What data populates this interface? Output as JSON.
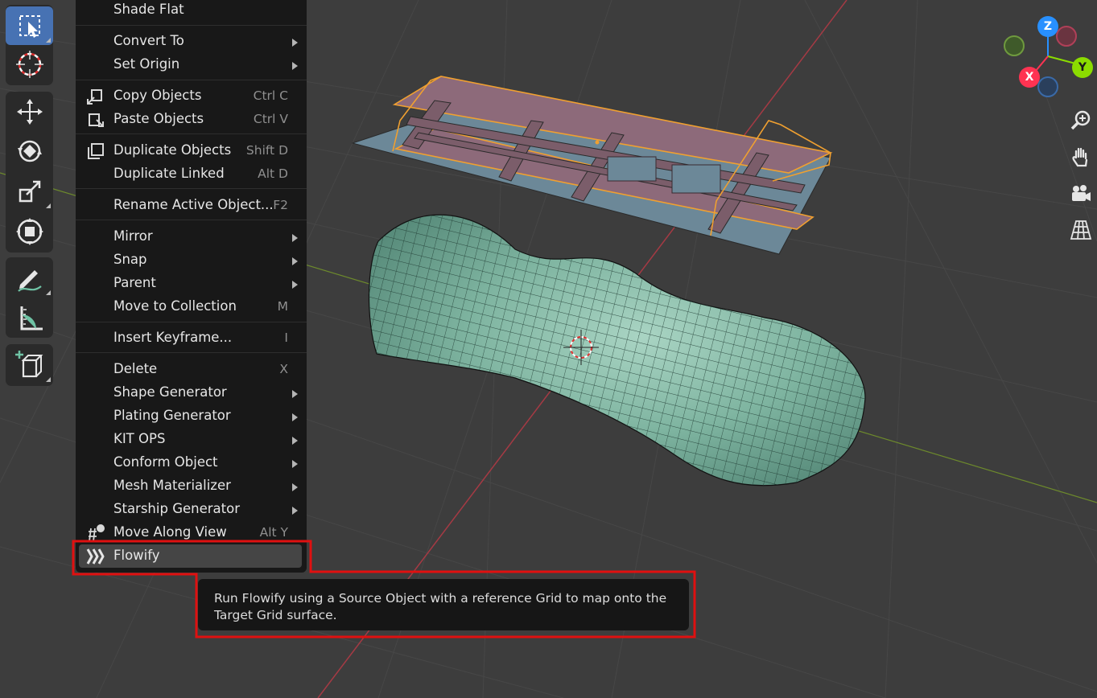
{
  "toolbar": {
    "tools": [
      {
        "icon": "select-box-icon",
        "active": true
      },
      {
        "icon": "cursor-icon",
        "active": false
      },
      {
        "icon": "move-icon",
        "active": false
      },
      {
        "icon": "rotate-icon",
        "active": false
      },
      {
        "icon": "scale-icon",
        "active": false
      },
      {
        "icon": "transform-icon",
        "active": false
      },
      {
        "icon": "annotate-icon",
        "active": false
      },
      {
        "icon": "measure-icon",
        "active": false
      },
      {
        "icon": "add-cube-icon",
        "active": false
      }
    ]
  },
  "menu": {
    "items": [
      {
        "label": "Shade Flat",
        "shortcut": "",
        "submenu": false,
        "icon": ""
      },
      {
        "label": "Convert To",
        "shortcut": "",
        "submenu": true,
        "icon": ""
      },
      {
        "label": "Set Origin",
        "shortcut": "",
        "submenu": true,
        "icon": ""
      },
      {
        "label": "Copy Objects",
        "shortcut": "Ctrl C",
        "submenu": false,
        "icon": "copy-icon"
      },
      {
        "label": "Paste Objects",
        "shortcut": "Ctrl V",
        "submenu": false,
        "icon": "paste-icon"
      },
      {
        "label": "Duplicate Objects",
        "shortcut": "Shift D",
        "submenu": false,
        "icon": "duplicate-icon"
      },
      {
        "label": "Duplicate Linked",
        "shortcut": "Alt D",
        "submenu": false,
        "icon": ""
      },
      {
        "label": "Rename Active Object...",
        "shortcut": "F2",
        "submenu": false,
        "icon": ""
      },
      {
        "label": "Mirror",
        "shortcut": "",
        "submenu": true,
        "icon": ""
      },
      {
        "label": "Snap",
        "shortcut": "",
        "submenu": true,
        "icon": ""
      },
      {
        "label": "Parent",
        "shortcut": "",
        "submenu": true,
        "icon": ""
      },
      {
        "label": "Move to Collection",
        "shortcut": "M",
        "submenu": false,
        "icon": ""
      },
      {
        "label": "Insert Keyframe...",
        "shortcut": "I",
        "submenu": false,
        "icon": ""
      },
      {
        "label": "Delete",
        "shortcut": "X",
        "submenu": false,
        "icon": ""
      },
      {
        "label": "Shape Generator",
        "shortcut": "",
        "submenu": true,
        "icon": ""
      },
      {
        "label": "Plating Generator",
        "shortcut": "",
        "submenu": true,
        "icon": ""
      },
      {
        "label": "KIT OPS",
        "shortcut": "",
        "submenu": true,
        "icon": ""
      },
      {
        "label": "Conform Object",
        "shortcut": "",
        "submenu": true,
        "icon": ""
      },
      {
        "label": "Mesh Materializer",
        "shortcut": "",
        "submenu": true,
        "icon": ""
      },
      {
        "label": "Starship Generator",
        "shortcut": "",
        "submenu": true,
        "icon": ""
      },
      {
        "label": "Move Along View",
        "shortcut": "Alt Y",
        "submenu": false,
        "icon": "move-along-view-icon"
      },
      {
        "label": "Flowify",
        "shortcut": "",
        "submenu": false,
        "icon": "flowify-icon"
      }
    ]
  },
  "tooltip": {
    "text": "Run Flowify using a Source Object with a reference Grid to map onto the Target Grid surface."
  },
  "gizmo": {
    "z_label": "Z",
    "y_label": "Y",
    "x_label": "X"
  },
  "navigation": [
    {
      "icon": "zoom-icon"
    },
    {
      "icon": "pan-hand-icon"
    },
    {
      "icon": "camera-icon"
    },
    {
      "icon": "grid-perspective-icon"
    }
  ],
  "colors": {
    "background": "#3d3d3d",
    "active_tool": "#4772b3",
    "selection_outline": "#f0a030",
    "x_axis": "#ff3352",
    "y_axis": "#8bdc00",
    "z_axis": "#2890ff",
    "highlight_frame": "#e01010"
  }
}
